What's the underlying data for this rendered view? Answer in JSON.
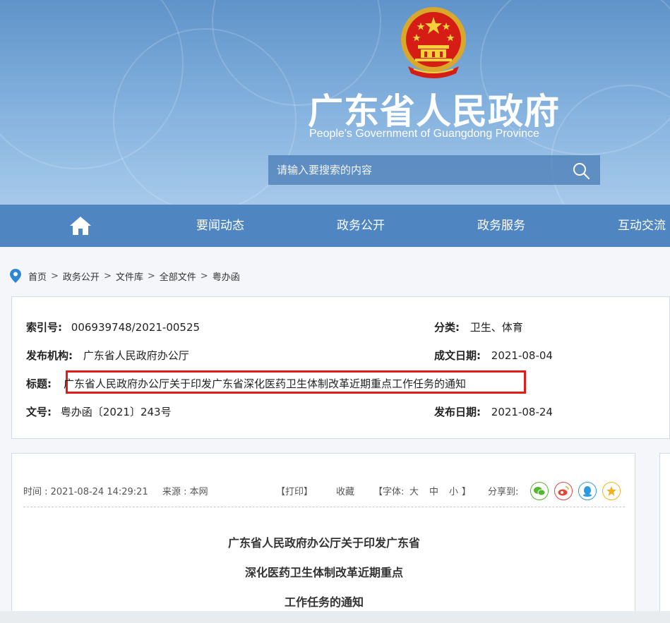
{
  "header": {
    "title": "广东省人民政府",
    "subtitle": "People's Government of Guangdong Province",
    "search_placeholder": "请输入要搜索的内容"
  },
  "nav": {
    "items": [
      "要闻动态",
      "政务公开",
      "政务服务",
      "互动交流"
    ]
  },
  "breadcrumb": [
    "首页",
    "政务公开",
    "文件库",
    "全部文件",
    "粤办函"
  ],
  "meta": {
    "index_label": "索引号:",
    "index_value": "006939748/2021-00525",
    "category_label": "分类:",
    "category_value": "卫生、体育",
    "publisher_label": "发布机构:",
    "publisher_value": "广东省人民政府办公厅",
    "created_label": "成文日期:",
    "created_value": "2021-08-04",
    "title_label": "标题:",
    "title_value": "广东省人民政府办公厅关于印发广东省深化医药卫生体制改革近期重点工作任务的通知",
    "docno_label": "文号:",
    "docno_value": "粤办函〔2021〕243号",
    "published_label": "发布日期:",
    "published_value": "2021-08-24"
  },
  "article": {
    "time": "时间 : 2021-08-24 14:29:21",
    "source": "来源 : 本网",
    "print": "【打印】",
    "favorite": "收藏",
    "font_label": "【字体:",
    "font_large": "大",
    "font_medium": "中",
    "font_small": "小",
    "font_close": "】",
    "share_label": "分享到:",
    "title_lines": [
      "广东省人民政府办公厅关于印发广东省",
      "深化医药卫生体制改革近期重点",
      "工作任务的通知"
    ]
  },
  "colors": {
    "nav_bg": "#4f86c2",
    "highlight_border": "#e11a1a",
    "wechat": "#53b62f",
    "weibo": "#e2483a",
    "qq": "#2a9be0",
    "qzone": "#f3b21c"
  },
  "icons": [
    "emblem",
    "home-icon",
    "search-icon",
    "location-pin-icon",
    "wechat-icon",
    "weibo-icon",
    "qq-icon",
    "qzone-icon"
  ]
}
